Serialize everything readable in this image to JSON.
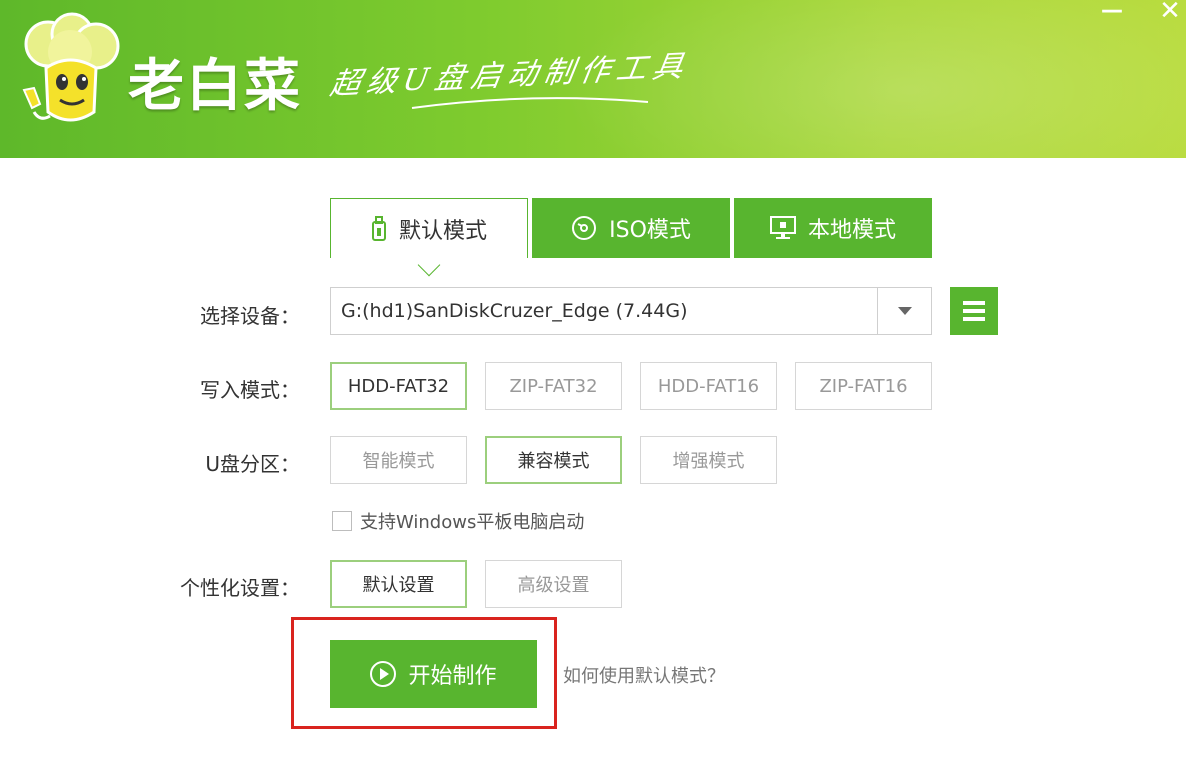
{
  "header": {
    "brand": "老白菜",
    "slogan": "超级U盘启动制作工具",
    "minimize_glyph": "—",
    "close_glyph": "✕"
  },
  "tabs": [
    {
      "label": "默认模式",
      "icon": "usb-drive-icon",
      "active": true
    },
    {
      "label": "ISO模式",
      "icon": "disc-icon",
      "active": false
    },
    {
      "label": "本地模式",
      "icon": "monitor-icon",
      "active": false
    }
  ],
  "device": {
    "label": "选择设备：",
    "value": "G:(hd1)SanDiskCruzer_Edge (7.44G)"
  },
  "write_mode": {
    "label": "写入模式：",
    "options": [
      "HDD-FAT32",
      "ZIP-FAT32",
      "HDD-FAT16",
      "ZIP-FAT16"
    ],
    "selected": "HDD-FAT32"
  },
  "partition": {
    "label": "U盘分区：",
    "options": [
      "智能模式",
      "兼容模式",
      "增强模式"
    ],
    "selected": "兼容模式"
  },
  "tablet_boot": {
    "label": "支持Windows平板电脑启动",
    "checked": false
  },
  "personalize": {
    "label": "个性化设置：",
    "options": [
      "默认设置",
      "高级设置"
    ],
    "selected": "默认设置"
  },
  "start": {
    "label": "开始制作",
    "help": "如何使用默认模式？"
  },
  "colors": {
    "accent": "#58b52f",
    "highlight": "#d9231e"
  }
}
